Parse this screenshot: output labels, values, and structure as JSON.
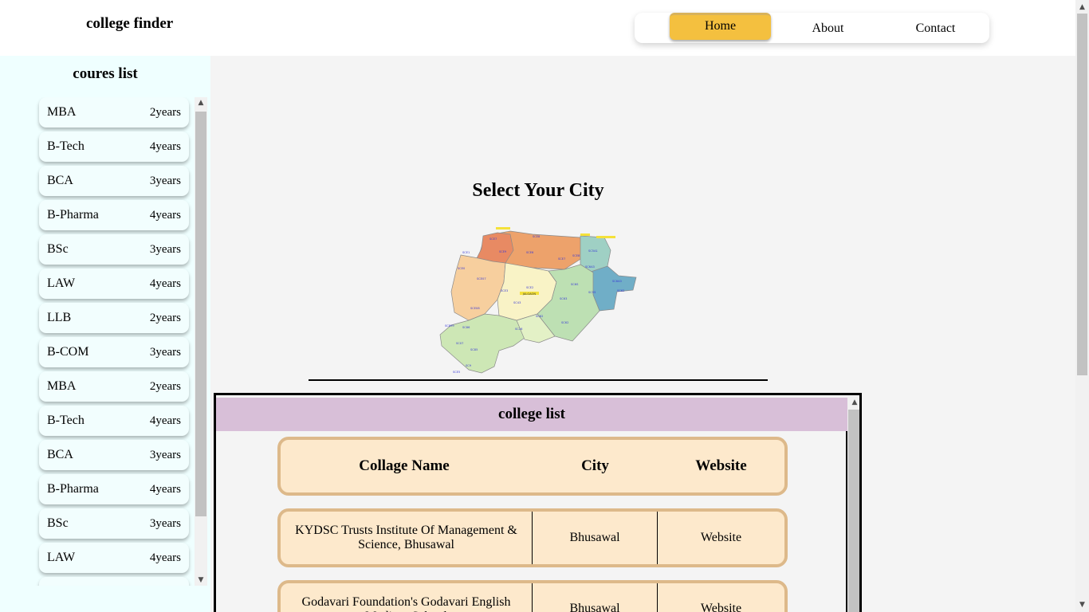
{
  "header": {
    "brand": "college finder",
    "nav": [
      {
        "label": "Home",
        "active": true
      },
      {
        "label": "About",
        "active": false
      },
      {
        "label": "Contact",
        "active": false
      }
    ]
  },
  "sidebar": {
    "title": "coures list",
    "courses": [
      {
        "name": "MBA",
        "duration": "2years"
      },
      {
        "name": "B-Tech",
        "duration": "4years"
      },
      {
        "name": "BCA",
        "duration": "3years"
      },
      {
        "name": "B-Pharma",
        "duration": "4years"
      },
      {
        "name": "BSc",
        "duration": "3years"
      },
      {
        "name": "LAW",
        "duration": "4years"
      },
      {
        "name": "LLB",
        "duration": "2years"
      },
      {
        "name": "B-COM",
        "duration": "3years"
      },
      {
        "name": "MBA",
        "duration": "2years"
      },
      {
        "name": "B-Tech",
        "duration": "4years"
      },
      {
        "name": "BCA",
        "duration": "3years"
      },
      {
        "name": "B-Pharma",
        "duration": "4years"
      },
      {
        "name": "BSc",
        "duration": "3years"
      },
      {
        "name": "LAW",
        "duration": "4years"
      },
      {
        "name": "",
        "duration": ""
      }
    ]
  },
  "main": {
    "title": "Select Your City",
    "map_label": "JALGAON",
    "college_list": {
      "title": "college list",
      "headers": {
        "name": "Collage Name",
        "city": "City",
        "website": "Website"
      },
      "rows": [
        {
          "name": "KYDSC Trusts Institute Of Management & Science, Bhusawal",
          "city": "Bhusawal",
          "website": "Website"
        },
        {
          "name": "Godavari Foundation's Godavari English Medium School",
          "city": "Bhusawal",
          "website": "Website"
        }
      ]
    }
  },
  "colors": {
    "nav_active": "#f4c03f",
    "sidebar_bg": "#efffff",
    "college_header_bg": "#d8bfd8",
    "row_bg": "#fde9cc",
    "row_border": "#ddb98a"
  }
}
